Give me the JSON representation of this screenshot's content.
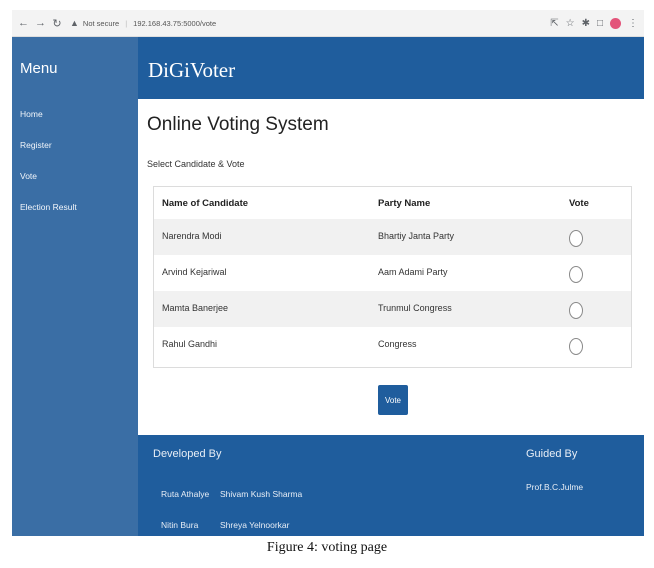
{
  "browser": {
    "security_label": "Not secure",
    "url": "192.168.43.75:5000/vote"
  },
  "sidebar": {
    "title": "Menu",
    "items": [
      {
        "label": "Home"
      },
      {
        "label": "Register"
      },
      {
        "label": "Vote"
      },
      {
        "label": "Election Result"
      }
    ]
  },
  "header": {
    "brand": "DiGiVoter"
  },
  "main": {
    "title": "Online Voting System",
    "subtitle": "Select Candidate & Vote",
    "table": {
      "headers": [
        "Name of Candidate",
        "Party Name",
        "Vote"
      ],
      "rows": [
        {
          "candidate": "Narendra Modi",
          "party": "Bhartiy Janta Party"
        },
        {
          "candidate": "Arvind Kejariwal",
          "party": "Aam Adami Party"
        },
        {
          "candidate": "Mamta Banerjee",
          "party": "Trunmul Congress"
        },
        {
          "candidate": "Rahul Gandhi",
          "party": "Congress"
        }
      ]
    },
    "vote_button": "Vote"
  },
  "footer": {
    "developed_by_label": "Developed By",
    "developers": [
      "Ruta Athalye",
      "Shivam Kush Sharma",
      "Nitin Bura",
      "Shreya Yelnoorkar"
    ],
    "guided_by_label": "Guided By",
    "guide": "Prof.B.C.Julme"
  },
  "caption": "Figure 4: voting page",
  "colors": {
    "sidebar": "#3a6ea5",
    "header": "#1f5d9d",
    "accent": "#1f5d9d"
  }
}
